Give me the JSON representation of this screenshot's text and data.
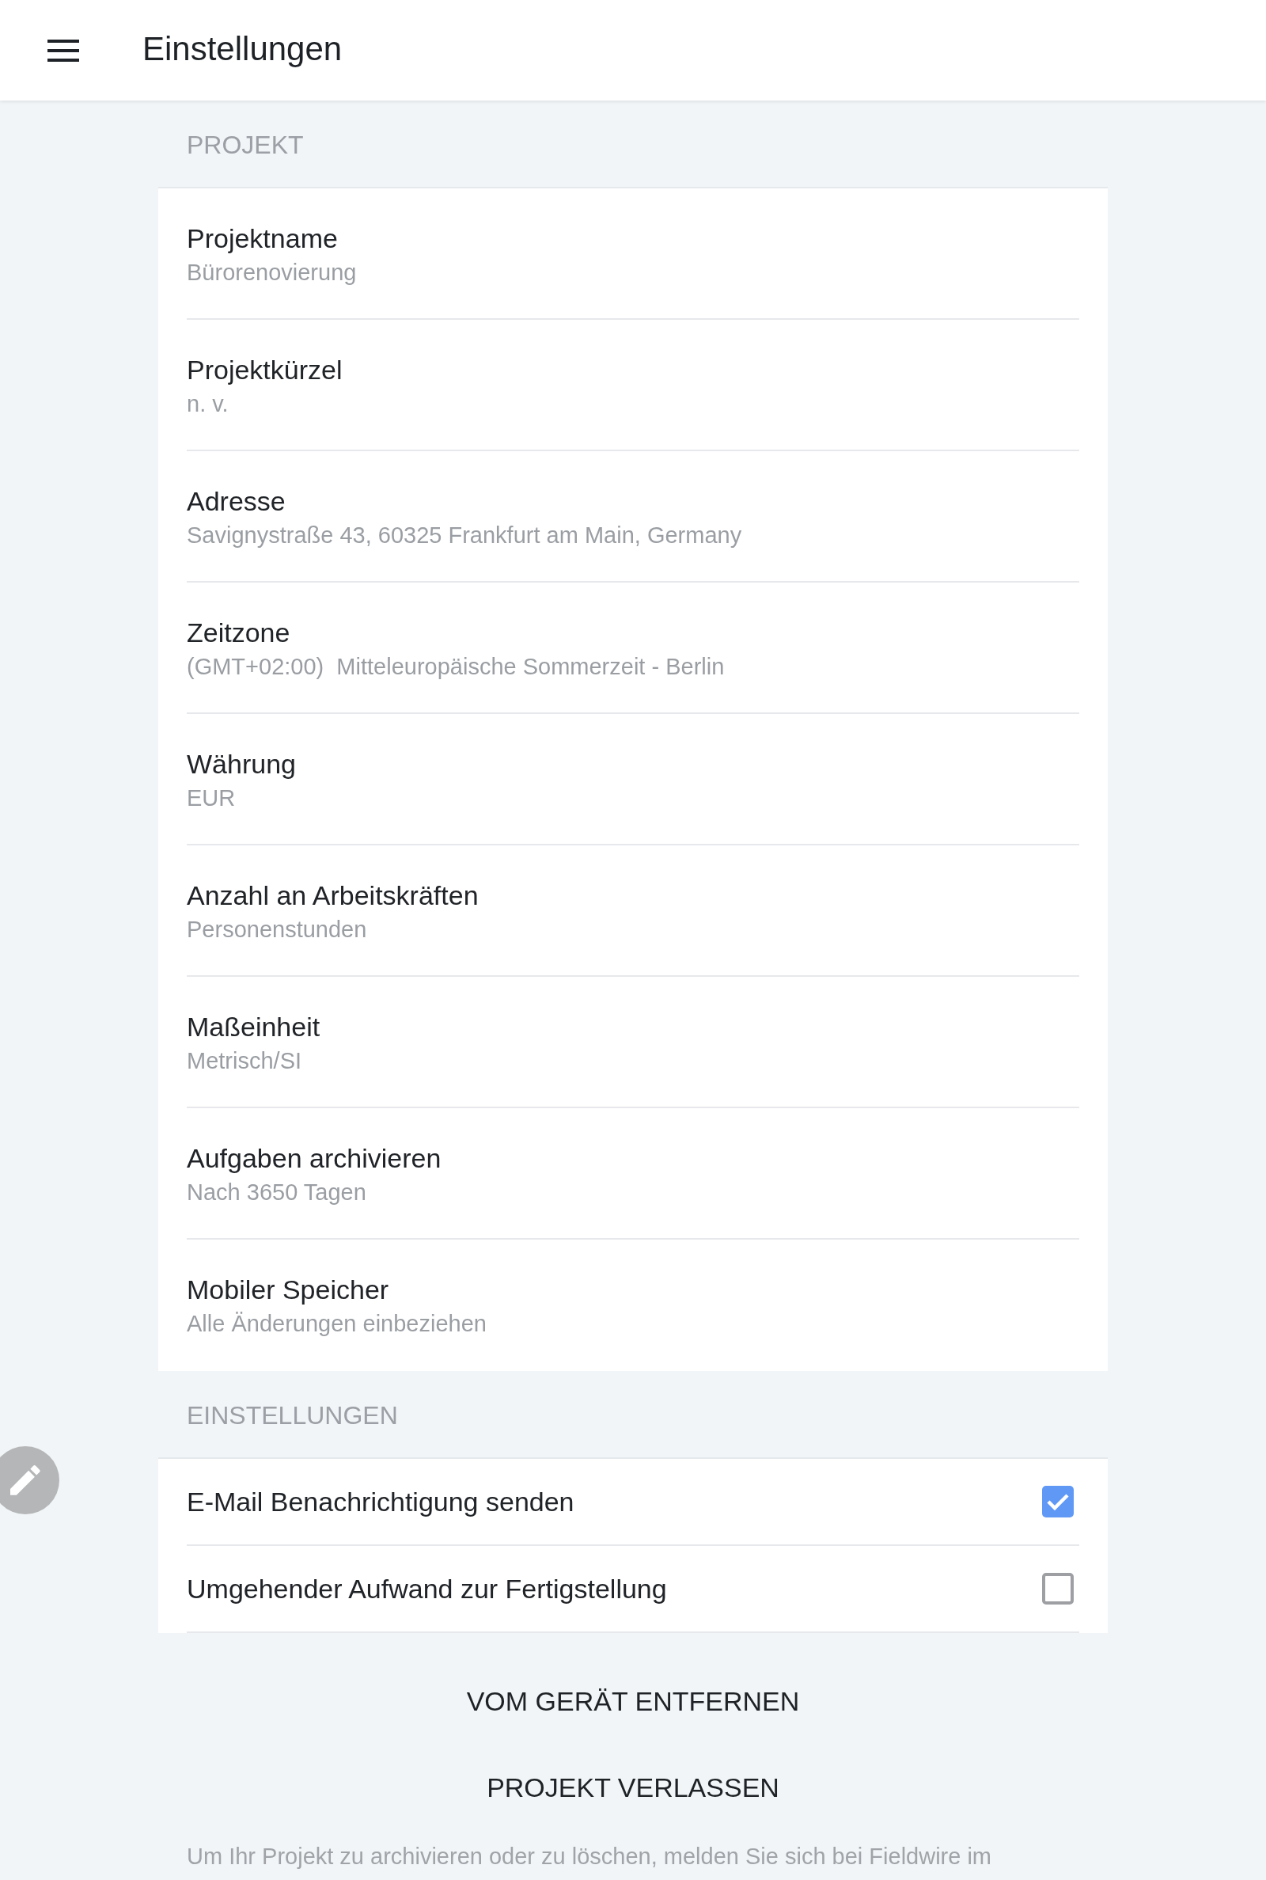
{
  "header": {
    "title": "Einstellungen"
  },
  "sections": [
    {
      "heading": "PROJEKT",
      "rows": [
        {
          "kind": "value",
          "label": "Projektname",
          "value": "Bürorenovierung"
        },
        {
          "kind": "value",
          "label": "Projektkürzel",
          "value": "n. v."
        },
        {
          "kind": "value",
          "label": "Adresse",
          "value": "Savignystraße 43, 60325 Frankfurt am Main, Germany"
        },
        {
          "kind": "value",
          "label": "Zeitzone",
          "value": "(GMT+02:00)  Mitteleuropäische Sommerzeit - Berlin"
        },
        {
          "kind": "value",
          "label": "Währung",
          "value": "EUR"
        },
        {
          "kind": "value",
          "label": "Anzahl an Arbeitskräften",
          "value": "Personenstunden"
        },
        {
          "kind": "value",
          "label": "Maßeinheit",
          "value": "Metrisch/SI"
        },
        {
          "kind": "value",
          "label": "Aufgaben archivieren",
          "value": "Nach 3650 Tagen"
        },
        {
          "kind": "value",
          "label": "Mobiler Speicher",
          "value": "Alle Änderungen einbeziehen"
        }
      ]
    },
    {
      "heading": "EINSTELLUNGEN",
      "rows": [
        {
          "kind": "checkbox",
          "label": "E-Mail Benachrichtigung senden",
          "checked": true
        },
        {
          "kind": "checkbox",
          "label": "Umgehender Aufwand zur Fertigstellung",
          "checked": false
        }
      ]
    }
  ],
  "actions": [
    "VOM GERÄT ENTFERNEN",
    "PROJEKT VERLASSEN"
  ],
  "footer_note": "Um Ihr Projekt zu archivieren oder zu löschen, melden Sie sich bei Fieldwire im"
}
